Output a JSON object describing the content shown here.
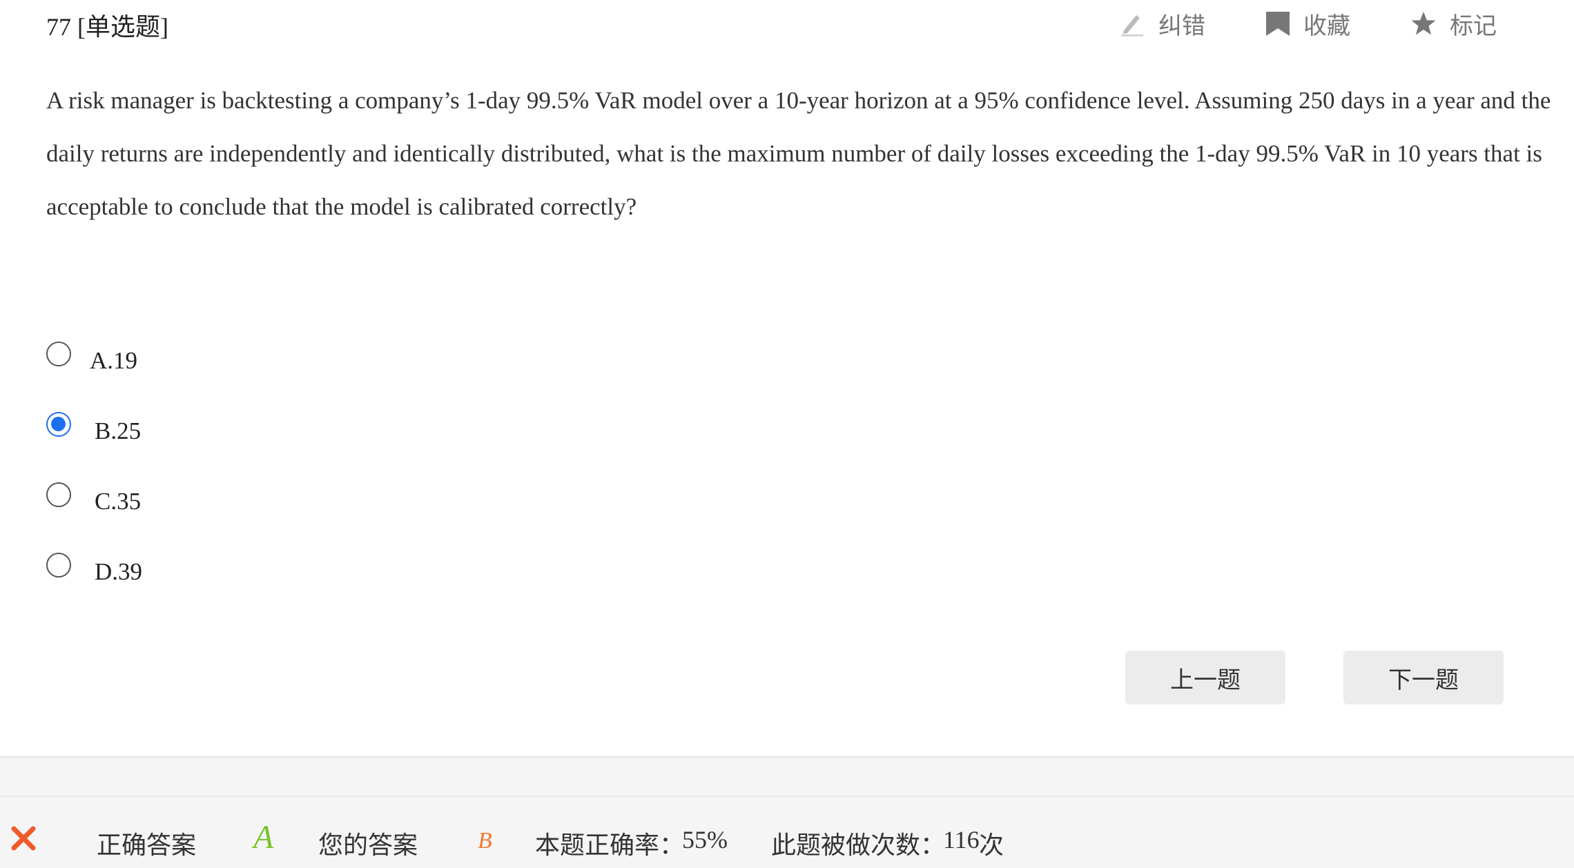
{
  "header": {
    "question_number": "77 [单选题]",
    "tools": {
      "correct_error": "纠错",
      "favorite": "收藏",
      "mark": "标记"
    }
  },
  "question": {
    "text": "A risk manager is backtesting a company’s 1-day 99.5% VaR model over a 10-year horizon at a 95% confidence level. Assuming 250 days in a year and the daily returns are independently and identically distributed, what is the maximum number of daily losses exceeding the 1-day 99.5% VaR in 10 years that is acceptable to conclude that the model is calibrated correctly?"
  },
  "options": [
    {
      "label": "A.19",
      "selected": false
    },
    {
      "label": "B.25",
      "selected": true
    },
    {
      "label": "C.35",
      "selected": false
    },
    {
      "label": "D.39",
      "selected": false
    }
  ],
  "navigation": {
    "prev_label": "上一题",
    "next_label": "下一题"
  },
  "result": {
    "status_icon": "close-icon",
    "correct_answer_label": "正确答案",
    "correct_answer": "A",
    "your_answer_label": "您的答案",
    "your_answer": "B",
    "accuracy_label": "本题正确率：",
    "accuracy_value": "55%",
    "attempts_label": "此题被做次数：",
    "attempts_value": "116",
    "attempts_unit": "次"
  },
  "colors": {
    "accent_blue": "#1e6ff0",
    "correct_green": "#7cc22f",
    "wrong_orange": "#f07a2e",
    "wrong_red": "#f05a2a"
  }
}
